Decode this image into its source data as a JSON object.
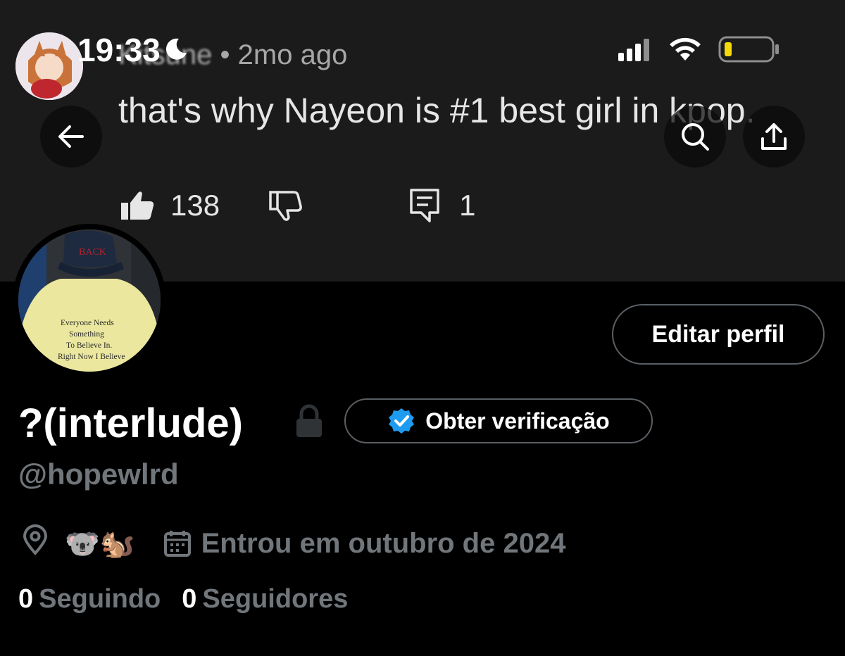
{
  "status_bar": {
    "time": "19:33",
    "moon_icon": "moon-icon",
    "signal_icon": "cellular-signal-icon",
    "wifi_icon": "wifi-icon",
    "battery_icon": "battery-low-icon",
    "battery_color": "#f5d90a"
  },
  "banner": {
    "comment_time": "• 2mo ago",
    "comment_text": "that's why Nayeon is #1 best girl in kpop.",
    "likes": "138",
    "replies": "1"
  },
  "nav": {
    "back_icon": "back-arrow-icon",
    "search_icon": "search-icon",
    "share_icon": "share-icon"
  },
  "profile": {
    "edit_label": "Editar perfil",
    "display_name": "?(interlude)",
    "verify_label": "Obter verificação",
    "handle": "@hopewlrd",
    "location": "🐨🐿️",
    "joined": "Entrou em outubro de 2024",
    "following_count": "0",
    "following_label": "Seguindo",
    "followers_count": "0",
    "followers_label": "Seguidores",
    "avatar_shirt_text": [
      "Everyone Needs",
      "Something",
      "To Believe In.",
      "Right Now I Believe"
    ],
    "cap_text": "BACK"
  },
  "colors": {
    "background": "#000000",
    "muted": "#71767b",
    "verify_blue": "#1d9bf0",
    "banner_bg": "#1b1b1b"
  }
}
